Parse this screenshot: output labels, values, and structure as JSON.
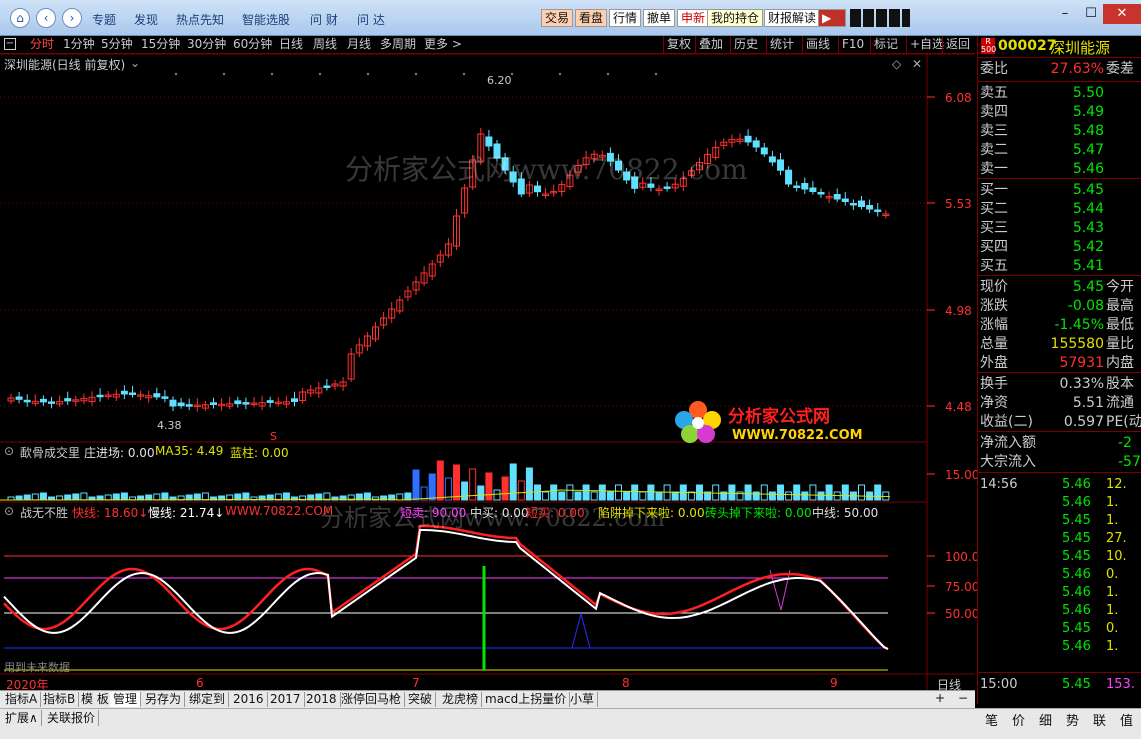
{
  "titlebar": {
    "nav_icons": [
      "home-icon",
      "back-icon",
      "forward-icon"
    ],
    "menus": [
      "专题",
      "发现",
      "热点先知",
      "智能选股",
      "问 财",
      "问 达"
    ],
    "buttons": [
      {
        "label": "交易",
        "color": "#ffd0b0"
      },
      {
        "label": "看盘",
        "color": "#ffd0b0"
      },
      {
        "label": "行情",
        "color": "#ffffff"
      },
      {
        "label": "撤单",
        "color": "#ffffff"
      },
      {
        "label": "申新",
        "color": "#ffffff"
      },
      {
        "label": "我的持仓",
        "color": "#ffffd0"
      },
      {
        "label": "财报解读",
        "color": "#ffffff"
      }
    ],
    "window_controls": [
      "minimize-icon",
      "maximize-icon",
      "close-icon"
    ]
  },
  "periodbar": {
    "periods": [
      "分时",
      "1分钟",
      "5分钟",
      "15分钟",
      "30分钟",
      "60分钟",
      "日线",
      "周线",
      "月线",
      "多周期",
      "更多 >"
    ],
    "active": "分时",
    "tools": [
      "复权",
      "叠加",
      "历史",
      "统计",
      "画线",
      "F10",
      "标记",
      "+自选",
      "返回"
    ]
  },
  "main_chart": {
    "title": "深圳能源(日线 前复权)",
    "high_label": "6.20",
    "low_label": "4.38",
    "y_ticks": [
      "6.08",
      "5.53",
      "4.98",
      "4.48"
    ],
    "watermark": "分析家公式网www.70822.com",
    "logo_text": "分析家公式网",
    "logo_url": "WWW.70822.COM",
    "s_marker": "S"
  },
  "volume_panel": {
    "title": "歃骨成交里",
    "legend": [
      {
        "label": "庄进场: 0.00",
        "color": "#e0e0e0"
      },
      {
        "label": "MA35: 4.49",
        "color": "#e0e000"
      },
      {
        "label": "蓝柱: 0.00",
        "color": "#e0e000"
      }
    ],
    "y_tick": "15.00"
  },
  "indicator_panel": {
    "title": "战无不胜",
    "legend": [
      {
        "label": "快线: 18.60↓",
        "color": "#ff3030"
      },
      {
        "label": "慢线: 21.74↓",
        "color": "#ffffff"
      },
      {
        "label": "WWW.70822.COM",
        "color": "#ff3030"
      },
      {
        "label": "短卖: 90.00",
        "color": "#ff40ff"
      },
      {
        "label": "中买: 0.00",
        "color": "#e0e0e0"
      },
      {
        "label": "短买: 0.00",
        "color": "#ff3030"
      },
      {
        "label": "陷阱掉下来啦: 0.00",
        "color": "#e0e000"
      },
      {
        "label": "砖头掉下来啦: 0.00",
        "color": "#00e600"
      },
      {
        "label": "中线: 50.00",
        "color": "#e0e0e0"
      }
    ],
    "y_ticks": [
      "100.0",
      "75.00",
      "50.00"
    ],
    "footnote": "用到未来数据"
  },
  "x_axis": {
    "labels": [
      "2020年",
      "6",
      "7",
      "8",
      "9"
    ],
    "period": "日线"
  },
  "quote": {
    "code": "000027",
    "name": "深圳能源",
    "badge_top": "R",
    "badge_bottom": "500",
    "weibi_label": "委比",
    "weibi_value": "27.63%",
    "weicha_label": "委差",
    "asks": [
      {
        "label": "卖五",
        "price": "5.50"
      },
      {
        "label": "卖四",
        "price": "5.49"
      },
      {
        "label": "卖三",
        "price": "5.48"
      },
      {
        "label": "卖二",
        "price": "5.47"
      },
      {
        "label": "卖一",
        "price": "5.46"
      }
    ],
    "bids": [
      {
        "label": "买一",
        "price": "5.45"
      },
      {
        "label": "买二",
        "price": "5.44"
      },
      {
        "label": "买三",
        "price": "5.43"
      },
      {
        "label": "买四",
        "price": "5.42"
      },
      {
        "label": "买五",
        "price": "5.41"
      }
    ],
    "stats": [
      {
        "label": "现价",
        "value": "5.45",
        "color": "#00e600",
        "label2": "今开"
      },
      {
        "label": "涨跌",
        "value": "-0.08",
        "color": "#00e600",
        "label2": "最高"
      },
      {
        "label": "涨幅",
        "value": "-1.45%",
        "color": "#00e600",
        "label2": "最低"
      },
      {
        "label": "总量",
        "value": "155580",
        "color": "#e0e000",
        "label2": "量比"
      },
      {
        "label": "外盘",
        "value": "57931",
        "color": "#ff3030",
        "label2": "内盘"
      }
    ],
    "stats2": [
      {
        "label": "换手",
        "value": "0.33%",
        "label2": "股本"
      },
      {
        "label": "净资",
        "value": "5.51",
        "label2": "流通"
      },
      {
        "label": "收益(二)",
        "value": "0.597",
        "label2": "PE(动"
      }
    ],
    "flows": [
      {
        "label": "净流入额",
        "value": "-2"
      },
      {
        "label": "大宗流入",
        "value": "-57"
      }
    ],
    "ticks": [
      {
        "time": "14:56",
        "price": "5.46",
        "vol": "12."
      },
      {
        "time": "",
        "price": "5.46",
        "vol": "1."
      },
      {
        "time": "",
        "price": "5.45",
        "vol": "1."
      },
      {
        "time": "",
        "price": "5.45",
        "vol": "27."
      },
      {
        "time": "",
        "price": "5.45",
        "vol": "10."
      },
      {
        "time": "",
        "price": "5.46",
        "vol": "0."
      },
      {
        "time": "",
        "price": "5.46",
        "vol": "1."
      },
      {
        "time": "",
        "price": "5.46",
        "vol": "1."
      },
      {
        "time": "",
        "price": "5.45",
        "vol": "0."
      },
      {
        "time": "",
        "price": "5.46",
        "vol": "1."
      }
    ],
    "last_tick": {
      "time": "15:00",
      "price": "5.45",
      "vol": "153."
    }
  },
  "bottombar": {
    "tabs": [
      "指标A",
      "指标B",
      "模 板",
      "管理",
      "另存为",
      "绑定到",
      "2016",
      "2017",
      "2018",
      "涨停回马枪",
      "突破",
      "龙虎榜",
      "macd上拐量价",
      "小草"
    ],
    "active": "管理",
    "row2": [
      "扩展∧",
      "关联报价"
    ],
    "right_tabs": [
      "笔",
      "价",
      "细",
      "势",
      "联",
      "值"
    ],
    "plusminus": [
      "+",
      "−"
    ]
  }
}
